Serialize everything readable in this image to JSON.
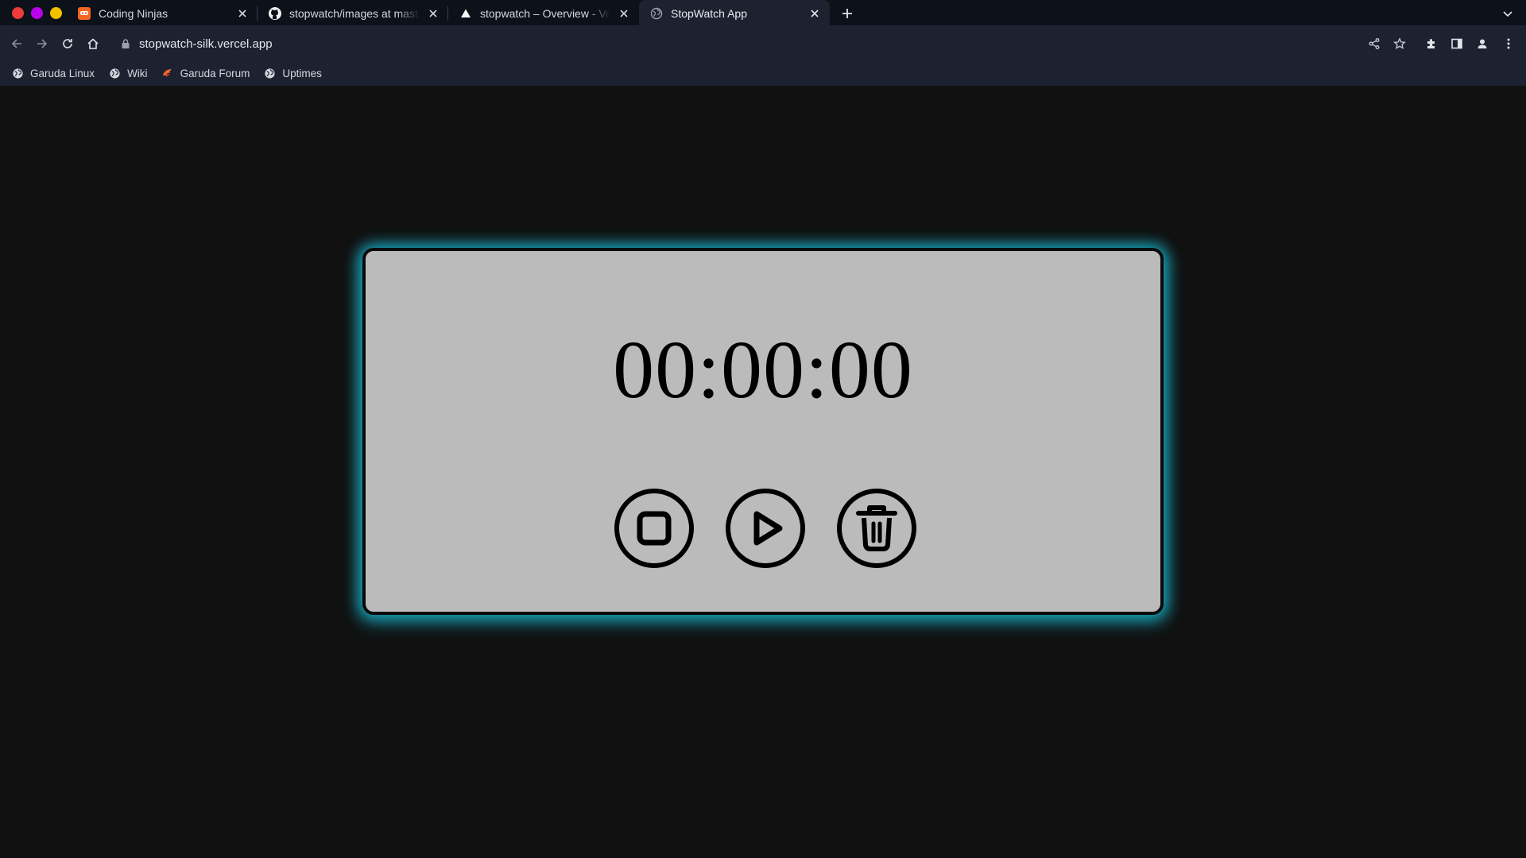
{
  "browser": {
    "tabs": [
      {
        "title": "Coding Ninjas",
        "icon": "coding-ninjas-icon",
        "active": false
      },
      {
        "title": "stopwatch/images at master",
        "icon": "github-icon",
        "active": false
      },
      {
        "title": "stopwatch – Overview - Vercel",
        "icon": "vercel-icon",
        "active": false
      },
      {
        "title": "StopWatch App",
        "icon": "globe-icon",
        "active": true
      }
    ],
    "url": "stopwatch-silk.vercel.app",
    "bookmarks": [
      {
        "label": "Garuda Linux",
        "icon": "globe-icon"
      },
      {
        "label": "Wiki",
        "icon": "globe-icon"
      },
      {
        "label": "Garuda Forum",
        "icon": "garuda-icon"
      },
      {
        "label": "Uptimes",
        "icon": "globe-icon"
      }
    ]
  },
  "app": {
    "time": "00:00:00",
    "controls": [
      {
        "name": "stop",
        "icon": "stop-icon"
      },
      {
        "name": "play",
        "icon": "play-icon"
      },
      {
        "name": "reset",
        "icon": "trash-icon"
      }
    ],
    "colors": {
      "panel": "#bbbbbb",
      "glow": "#18bed7",
      "background": "#111111"
    }
  }
}
